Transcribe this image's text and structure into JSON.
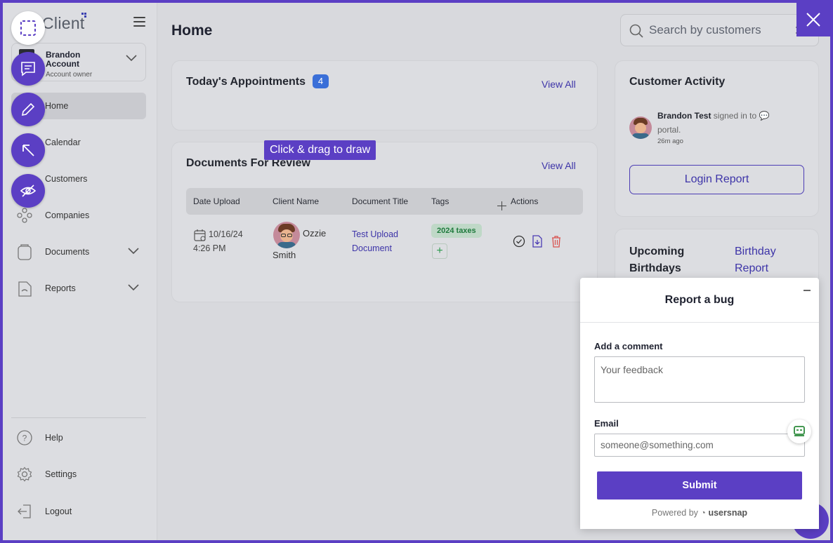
{
  "app": {
    "logo_text": "Client"
  },
  "sidebar": {
    "account": {
      "name": "Brandon Account",
      "role": "Account owner"
    },
    "items": [
      {
        "label": "Home",
        "icon": "home-icon",
        "active": true
      },
      {
        "label": "Calendar",
        "icon": "calendar-icon"
      },
      {
        "label": "Customers",
        "icon": "customers-icon"
      },
      {
        "label": "Companies",
        "icon": "companies-icon"
      },
      {
        "label": "Documents",
        "icon": "documents-icon",
        "expandable": true
      },
      {
        "label": "Reports",
        "icon": "reports-icon",
        "expandable": true
      }
    ],
    "bottom": [
      {
        "label": "Help",
        "icon": "help-icon"
      },
      {
        "label": "Settings",
        "icon": "gear-icon"
      },
      {
        "label": "Logout",
        "icon": "logout-icon"
      }
    ]
  },
  "header": {
    "title": "Home",
    "search_placeholder": "Search by customers"
  },
  "appointments": {
    "title": "Today's Appointments",
    "count": "4",
    "view_all": "View All"
  },
  "documents": {
    "title": "Documents For Review",
    "view_all": "View All",
    "columns": [
      "Date Upload",
      "Client Name",
      "Document Title",
      "Tags",
      "Actions"
    ],
    "rows": [
      {
        "date": "10/16/24",
        "time": "4:26 PM",
        "client_first": "Ozzie",
        "client_last": "Smith",
        "doc_line1": "Test Upload",
        "doc_line2": "Document",
        "tag": "2024 taxes"
      }
    ]
  },
  "activity": {
    "title": "Customer Activity",
    "user": "Brandon Test",
    "action": "signed in to",
    "target": "portal.",
    "time": "26m ago",
    "button": "Login Report"
  },
  "birthdays": {
    "title_line1": "Upcoming",
    "title_line2": "Birthdays",
    "link_line1": "Birthday",
    "link_line2": "Report"
  },
  "overlay": {
    "tooltip": "Click & drag to draw"
  },
  "bug_dialog": {
    "title": "Report a bug",
    "comment_label": "Add a comment",
    "comment_placeholder": "Your feedback",
    "email_label": "Email",
    "email_placeholder": "someone@something.com",
    "submit": "Submit",
    "powered_prefix": "Powered by",
    "powered_brand": "usersnap"
  },
  "colors": {
    "accent": "#5b3fc4",
    "link": "#3d34a8",
    "badge": "#3a6fd8",
    "tag_bg": "#bfd8c7",
    "tag_fg": "#1f7a3d"
  }
}
